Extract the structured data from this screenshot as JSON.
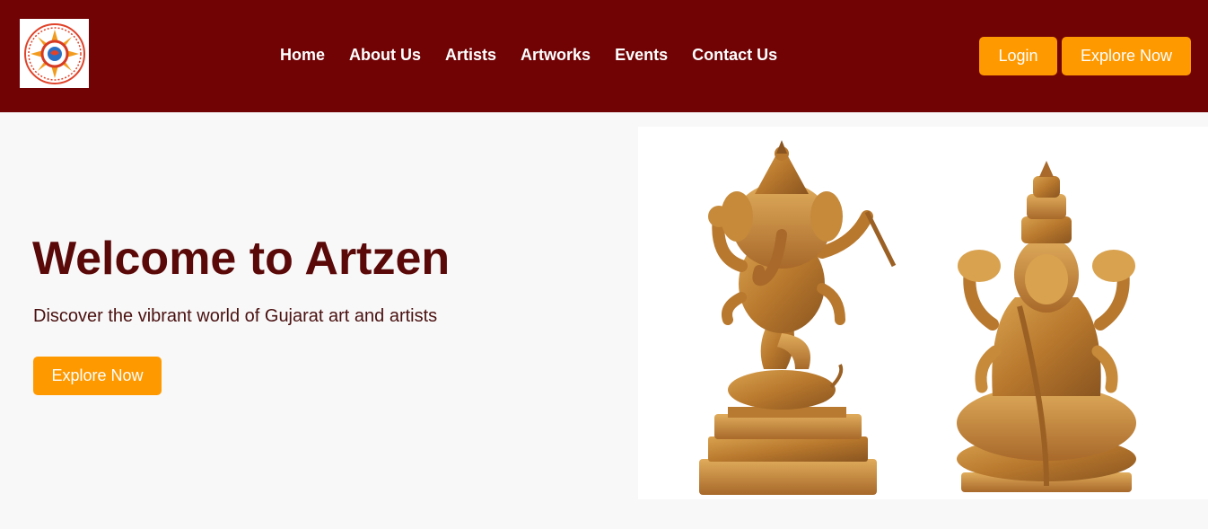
{
  "header": {
    "logo_alt": "Artzen logo",
    "nav": [
      "Home",
      "About Us",
      "Artists",
      "Artworks",
      "Events",
      "Contact Us"
    ],
    "login_label": "Login",
    "explore_label": "Explore Now"
  },
  "hero": {
    "title": "Welcome to Artzen",
    "subtitle": "Discover the vibrant world of Gujarat art and artists",
    "cta_label": "Explore Now",
    "image_alt": "Wooden carved statues of Ganesha and Lakshmi"
  },
  "colors": {
    "header_bg": "#710305",
    "accent": "#ff9900",
    "title": "#5a0808",
    "page_bg": "#f8f8f8"
  }
}
